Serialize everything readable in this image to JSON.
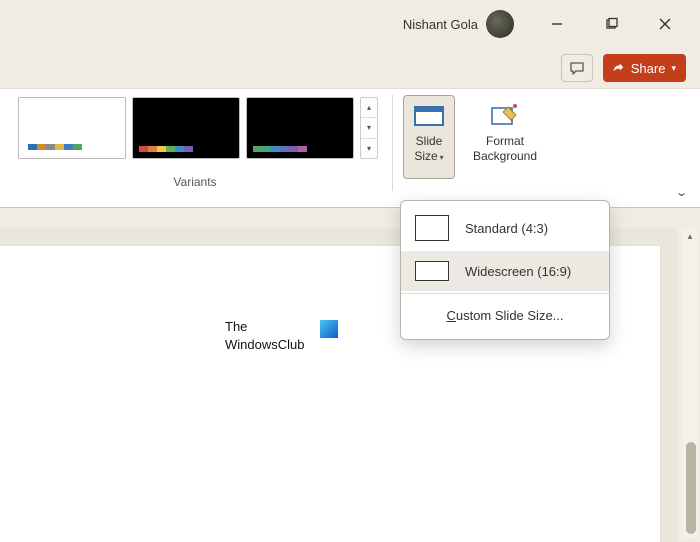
{
  "title_bar": {
    "user_name": "Nishant Gola"
  },
  "action_bar": {
    "share_label": "Share"
  },
  "ribbon": {
    "variants": {
      "label": "Variants",
      "palette_light": [
        "#2f6fb3",
        "#d68a2e",
        "#8a8a8a",
        "#e3b840",
        "#3d7fc1",
        "#5aa35a"
      ],
      "palette_dark1": [
        "#d24a43",
        "#e07f3a",
        "#edc94a",
        "#5fb05a",
        "#3d8fc1",
        "#7a5fb0"
      ],
      "palette_dark2": [
        "#5aa35a",
        "#3da588",
        "#3d8fc1",
        "#5f6fc1",
        "#7a5fb0",
        "#b05fa0"
      ]
    },
    "slide_size": {
      "line1": "Slide",
      "line2": "Size"
    },
    "format_bg": {
      "line1": "Format",
      "line2": "Background"
    }
  },
  "dropdown": {
    "standard": "Standard (4:3)",
    "widescreen": "Widescreen (16:9)",
    "custom_pre": "C",
    "custom_post": "ustom Slide Size..."
  },
  "slide": {
    "line1": "The",
    "line2": "WindowsClub"
  }
}
